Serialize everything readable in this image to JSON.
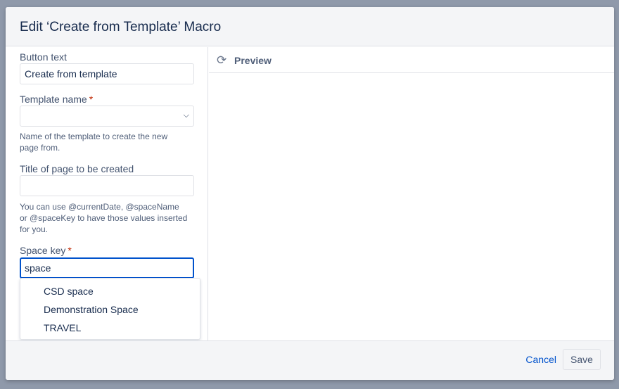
{
  "dialog": {
    "title": "Edit ‘Create from Template’ Macro"
  },
  "form": {
    "button_text": {
      "label": "Button text",
      "value": "Create from template"
    },
    "template_name": {
      "label": "Template name",
      "required": "*",
      "value": "",
      "help": "Name of the template to create the new page from."
    },
    "page_title": {
      "label": "Title of page to be created",
      "value": "",
      "help": "You can use @currentDate, @spaceName or @spaceKey to have those values inserted for you."
    },
    "space_key": {
      "label": "Space key",
      "required": "*",
      "value": "space",
      "options": [
        "CSD space",
        "Demonstration Space",
        "TRAVEL"
      ]
    }
  },
  "preview": {
    "label": "Preview",
    "icon": "refresh-icon"
  },
  "footer": {
    "cancel": "Cancel",
    "save": "Save"
  }
}
